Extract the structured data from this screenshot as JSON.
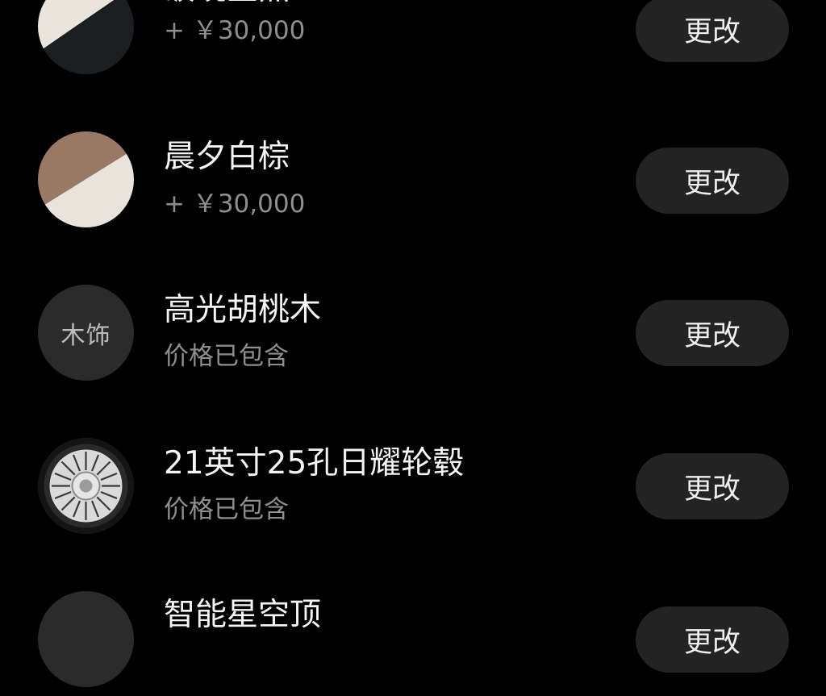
{
  "options": [
    {
      "title": "破晓金黑",
      "subtitle": "+ ￥30,000",
      "action_label": "更改",
      "swatch": {
        "type": "two-tone",
        "colors": [
          "#e9e5dc",
          "#1c1f22"
        ]
      }
    },
    {
      "title": "晨夕白棕",
      "subtitle": "+ ￥30,000",
      "action_label": "更改",
      "swatch": {
        "type": "two-tone",
        "colors": [
          "#9a7866",
          "#e8e4dc"
        ]
      }
    },
    {
      "title": "高光胡桃木",
      "subtitle": "价格已包含",
      "action_label": "更改",
      "swatch": {
        "type": "text",
        "label": "木饰"
      }
    },
    {
      "title": "21英寸25孔日耀轮毂",
      "subtitle": "价格已包含",
      "action_label": "更改",
      "swatch": {
        "type": "wheel-icon"
      }
    },
    {
      "title": "智能星空顶",
      "subtitle": "",
      "action_label": "更改",
      "swatch": {
        "type": "plain"
      }
    }
  ],
  "colors": {
    "background": "#000000",
    "button_bg": "#232323",
    "title_text": "#f4f4f4",
    "subtitle_text": "#8e8e8e"
  }
}
